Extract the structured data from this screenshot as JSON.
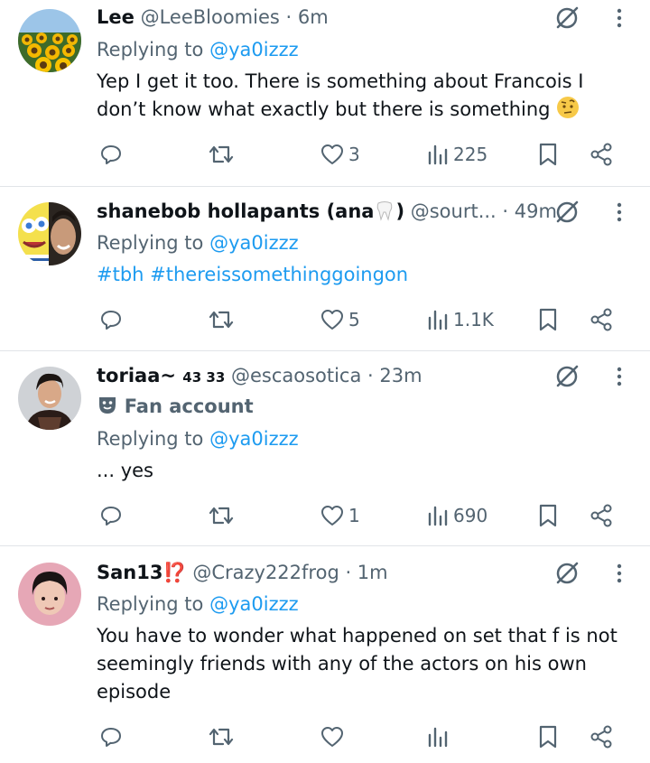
{
  "tweets": [
    {
      "name": "Lee",
      "name_suffix": "",
      "handle_time": "@LeeBloomies · 6m",
      "replying_label": "Replying to ",
      "replying_handle": "@ya0izzz",
      "badge": "",
      "body_lines": [
        "Yep I get it too. There is something about Francois I",
        "don’t know what exactly but there is something"
      ],
      "body_emoji": "🤨",
      "hashtags": [],
      "likes": "3",
      "views": "225"
    },
    {
      "name": "shanebob hollapants (ana",
      "name_suffix": ")",
      "name_emoji": "🦷",
      "handle_time": " @sourt...  · 49m",
      "replying_label": "Replying to ",
      "replying_handle": "@ya0izzz",
      "badge": "",
      "body_lines": [],
      "hashtags": [
        "#tbh",
        "#thereissomethinggoingon"
      ],
      "likes": "5",
      "views": "1.1K"
    },
    {
      "name": "toriaa~",
      "name_suffix": "43 33",
      "handle_time": " @escaosotica · 23m",
      "badge": "Fan account",
      "replying_label": "Replying to ",
      "replying_handle": "@ya0izzz",
      "body_lines": [
        "... yes"
      ],
      "hashtags": [],
      "likes": "1",
      "views": "690"
    },
    {
      "name": "San13",
      "name_emoji": "⁉️",
      "handle_time": " @Crazy222frog · 1m",
      "replying_label": "Replying to ",
      "replying_handle": "@ya0izzz",
      "badge": "",
      "body_lines": [
        "You have to wonder what happened on set that f is not",
        "seemingly friends with any of the actors on his own",
        "episode"
      ],
      "hashtags": [],
      "likes": "",
      "views": ""
    }
  ],
  "icons": {
    "reply": "reply-icon",
    "retweet": "retweet-icon",
    "like": "heart-icon",
    "views": "views-icon",
    "bookmark": "bookmark-icon",
    "share": "share-icon",
    "grok": "grok-icon",
    "more": "more-icon"
  },
  "colors": {
    "link": "#1d9bf0",
    "secondary": "#536471",
    "text": "#0f1419",
    "divider": "#e1e4e8"
  }
}
